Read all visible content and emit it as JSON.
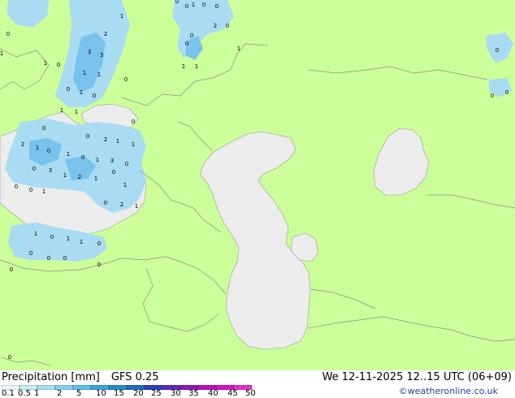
{
  "title": "Precipitation [mm]",
  "model": "GFS 0.25",
  "datetime": "We 12-11-2025 12..15 UTC (06+09)",
  "credit": "©weatheronline.co.uk",
  "legend": {
    "labels": [
      "0.1",
      "0.5",
      "1",
      "2",
      "5",
      "10",
      "15",
      "20",
      "25",
      "30",
      "35",
      "40",
      "45",
      "50"
    ],
    "colors": [
      "#e8f8fb",
      "#c8eef7",
      "#a4e2f4",
      "#7fd3ee",
      "#58c0e6",
      "#3aa6dc",
      "#2389cf",
      "#1a6cc0",
      "#2b3fb8",
      "#5b28b8",
      "#8a18b8",
      "#b510b8",
      "#d510c0",
      "#e830c8"
    ]
  },
  "colors": {
    "land": "#ccff99",
    "water": "#ececec",
    "rain_light": "#a9dbf2",
    "rain_moderate": "#78c3ec"
  },
  "map_values": [
    "1",
    "0",
    "2",
    "3",
    "3",
    "1",
    "0",
    "1",
    "1",
    "0",
    "0",
    "0",
    "1",
    "1",
    "2",
    "0",
    "1",
    "1",
    "0",
    "0",
    "0",
    "1",
    "1",
    "0",
    "0",
    "0",
    "0",
    "0",
    "0",
    "0",
    "1",
    "1",
    "0",
    "0",
    "2",
    "1",
    "1",
    "2",
    "1",
    "0",
    "1",
    "0",
    "1",
    "3",
    "0",
    "3",
    "0",
    "2",
    "1",
    "1",
    "0",
    "1",
    "0",
    "0",
    "1",
    "0",
    "2",
    "1",
    "1",
    "0",
    "1",
    "1",
    "0",
    "0",
    "0",
    "0",
    "0",
    "0",
    "0"
  ]
}
